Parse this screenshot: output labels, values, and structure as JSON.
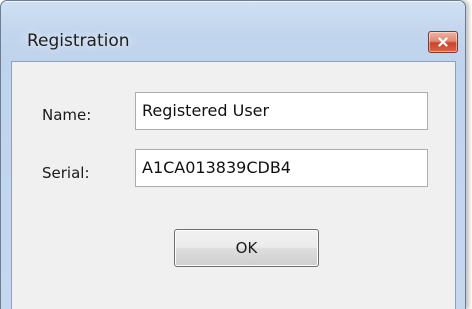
{
  "window": {
    "title": "Registration",
    "close_icon": "close-x-icon"
  },
  "form": {
    "name_label": "Name:",
    "name_value": "Registered User",
    "serial_label": "Serial:",
    "serial_value": "A1CA013839CDB4",
    "ok_label": "OK"
  },
  "colors": {
    "frame": "#bfd3ec",
    "client_background": "#f0f0f0",
    "close_button": "#c9452c"
  }
}
